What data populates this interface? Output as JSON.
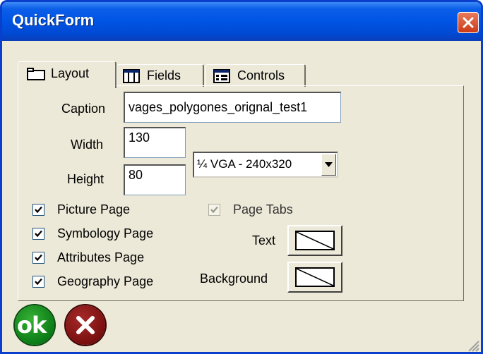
{
  "window": {
    "title": "QuickForm"
  },
  "tabs": [
    {
      "label": "Layout",
      "icon": "layout-icon",
      "active": true
    },
    {
      "label": "Fields",
      "icon": "fields-icon",
      "active": false
    },
    {
      "label": "Controls",
      "icon": "controls-icon",
      "active": false
    }
  ],
  "layout": {
    "caption_label": "Caption",
    "caption_value": "vages_polygones_orignal_test1",
    "width_label": "Width",
    "width_value": "130",
    "height_label": "Height",
    "height_value": "80",
    "screen_size": "¼ VGA - 240x320",
    "checkboxes": [
      {
        "label": "Picture Page",
        "checked": true
      },
      {
        "label": "Symbology Page",
        "checked": true
      },
      {
        "label": "Attributes Page",
        "checked": true
      },
      {
        "label": "Geography Page",
        "checked": true
      }
    ],
    "page_tabs": {
      "label": "Page Tabs",
      "checked": true,
      "enabled": false
    },
    "text_color_label": "Text",
    "background_color_label": "Background"
  },
  "buttons": {
    "ok_label": "ok"
  },
  "colors": {
    "titlebar": "#0054e3",
    "window_bg": "#ece9d8",
    "ok_green": "#0a7c16",
    "cancel_red": "#7a0f0f"
  }
}
